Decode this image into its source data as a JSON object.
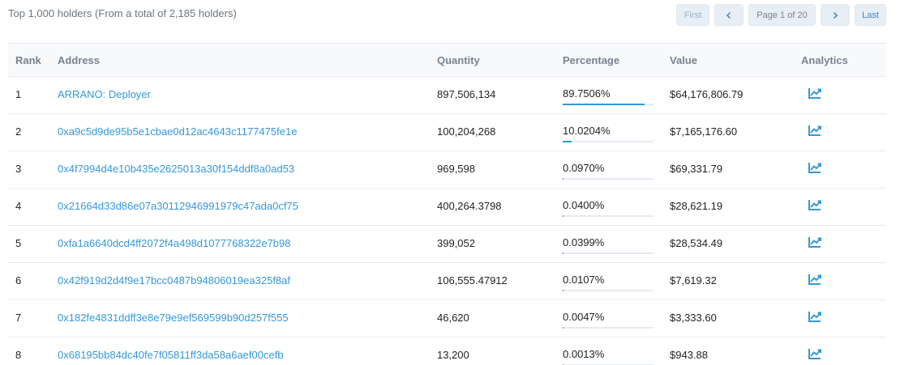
{
  "summary": "Top 1,000 holders (From a total of 2,185 holders)",
  "pager": {
    "first": "First",
    "page_info": "Page 1 of 20",
    "last": "Last"
  },
  "columns": {
    "rank": "Rank",
    "address": "Address",
    "quantity": "Quantity",
    "percentage": "Percentage",
    "value": "Value",
    "analytics": "Analytics"
  },
  "accent_color": "#3498db",
  "icons": {
    "prev": "chevron-left-icon",
    "next": "chevron-right-icon",
    "analytics": "chart-line-icon"
  },
  "rows": [
    {
      "rank": "1",
      "address": "ARRANO: Deployer",
      "quantity": "897,506,134",
      "percentage": "89.7506%",
      "pct_value": 89.7506,
      "value": "$64,176,806.79"
    },
    {
      "rank": "2",
      "address": "0xa9c5d9de95b5e1cbae0d12ac4643c1177475fe1e",
      "quantity": "100,204,268",
      "percentage": "10.0204%",
      "pct_value": 10.0204,
      "value": "$7,165,176.60"
    },
    {
      "rank": "3",
      "address": "0x4f7994d4e10b435e2625013a30f154ddf8a0ad53",
      "quantity": "969,598",
      "percentage": "0.0970%",
      "pct_value": 0.097,
      "value": "$69,331.79"
    },
    {
      "rank": "4",
      "address": "0x21664d33d86e07a30112946991979c47ada0cf75",
      "quantity": "400,264.3798",
      "percentage": "0.0400%",
      "pct_value": 0.04,
      "value": "$28,621.19"
    },
    {
      "rank": "5",
      "address": "0xfa1a6640dcd4ff2072f4a498d1077768322e7b98",
      "quantity": "399,052",
      "percentage": "0.0399%",
      "pct_value": 0.0399,
      "value": "$28,534.49"
    },
    {
      "rank": "6",
      "address": "0x42f919d2d4f9e17bcc0487b94806019ea325f8af",
      "quantity": "106,555.47912",
      "percentage": "0.0107%",
      "pct_value": 0.0107,
      "value": "$7,619.32"
    },
    {
      "rank": "7",
      "address": "0x182fe4831ddff3e8e79e9ef569599b90d257f555",
      "quantity": "46,620",
      "percentage": "0.0047%",
      "pct_value": 0.0047,
      "value": "$3,333.60"
    },
    {
      "rank": "8",
      "address": "0x68195bb84dc40fe7f05811ff3da58a6aef00cefb",
      "quantity": "13,200",
      "percentage": "0.0013%",
      "pct_value": 0.0013,
      "value": "$943.88"
    }
  ]
}
